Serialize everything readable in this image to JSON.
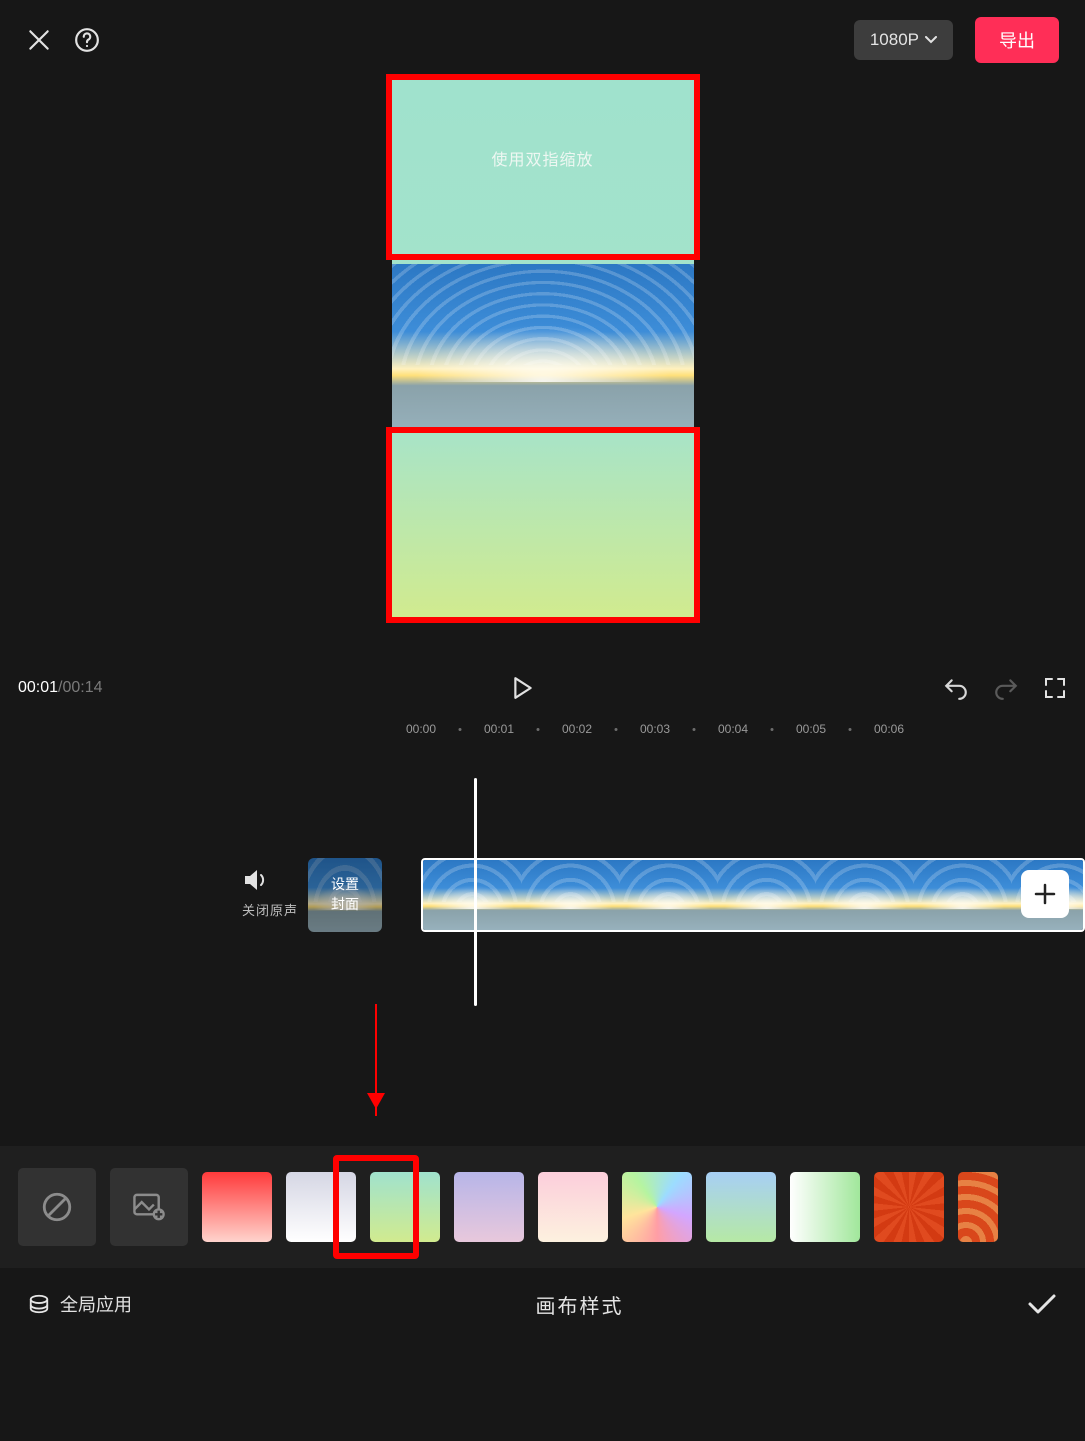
{
  "topbar": {
    "resolution_label": "1080P",
    "export_label": "导出"
  },
  "preview": {
    "hint_text": "使用双指缩放"
  },
  "player": {
    "current_time": "00:01",
    "duration": "00:14",
    "separator": " / "
  },
  "ruler": {
    "ticks": [
      "00:00",
      "00:01",
      "00:02",
      "00:03",
      "00:04",
      "00:05",
      "00:06"
    ]
  },
  "timeline": {
    "mute_label": "关闭原声",
    "cover_label_1": "设置",
    "cover_label_2": "封面"
  },
  "style_strip": {
    "items": [
      {
        "id": "none"
      },
      {
        "id": "image"
      },
      {
        "id": "red-grad"
      },
      {
        "id": "white-grad"
      },
      {
        "id": "mint-grad",
        "selected": true
      },
      {
        "id": "lavender-grad"
      },
      {
        "id": "pink-grad"
      },
      {
        "id": "rainbow"
      },
      {
        "id": "blue-green"
      },
      {
        "id": "green-white"
      },
      {
        "id": "sunburst"
      },
      {
        "id": "wave"
      }
    ]
  },
  "bottom": {
    "apply_all_label": "全局应用",
    "title": "画布样式"
  }
}
